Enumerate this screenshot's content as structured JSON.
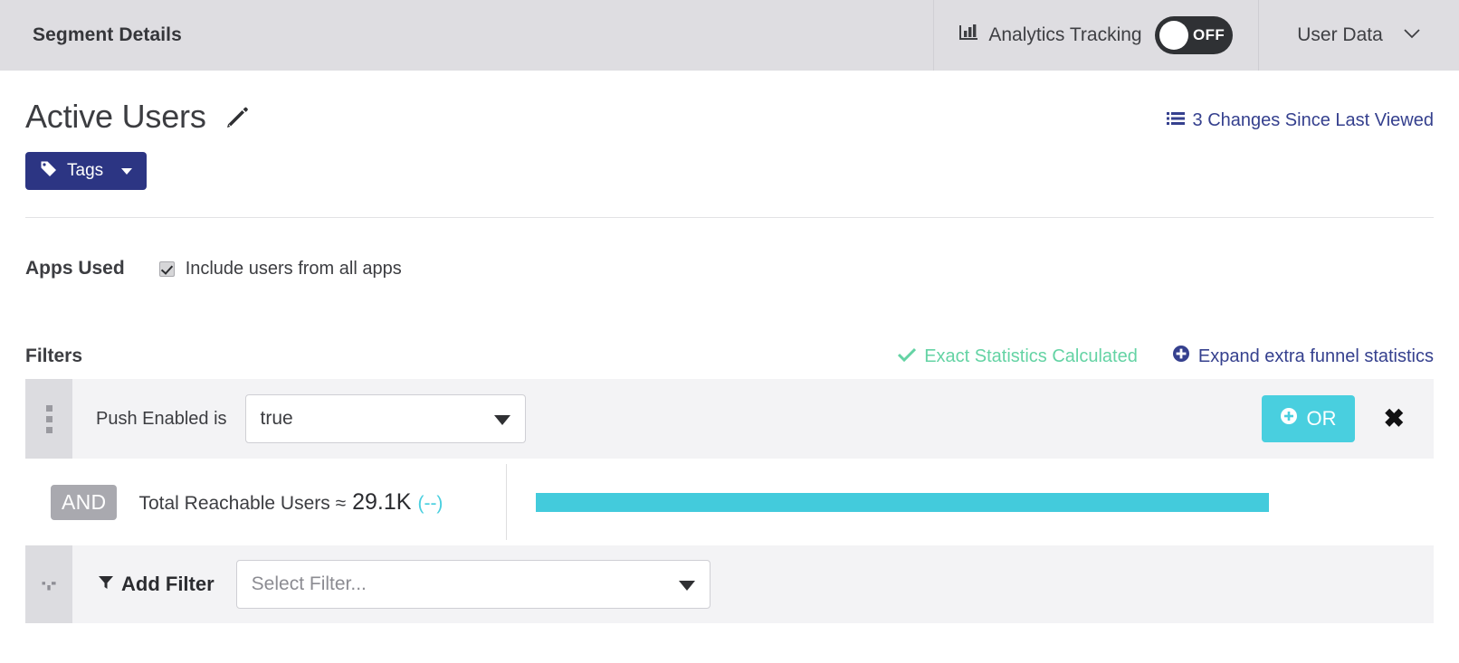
{
  "topbar": {
    "title": "Segment Details",
    "analytics_icon": "bar-chart-icon",
    "analytics_label": "Analytics Tracking",
    "toggle_state": "OFF",
    "user_menu_label": "User Data",
    "user_menu_icon": "chevron-down-icon"
  },
  "segment": {
    "name": "Active Users",
    "edit_icon": "pencil-icon",
    "changes_icon": "list-icon",
    "changes_label": "3 Changes Since Last Viewed",
    "tags_icon": "tag-icon",
    "tags_label": "Tags"
  },
  "apps": {
    "label": "Apps Used",
    "checkbox_checked": true,
    "checkbox_label": "Include users from all apps"
  },
  "filters": {
    "label": "Filters",
    "exact_stats_icon": "check-icon",
    "exact_stats_label": "Exact Statistics Calculated",
    "expand_icon": "plus-circle-icon",
    "expand_label": "Expand extra funnel statistics",
    "rows": [
      {
        "handle_icon": "drag-handle-icon",
        "field_label": "Push Enabled is",
        "value": "true",
        "or_icon": "plus-circle-icon",
        "or_label": "OR",
        "remove_icon": "close-icon"
      }
    ],
    "connector": "AND",
    "total": {
      "label": "Total Reachable Users ≈",
      "value": "29.1K",
      "delta": "(--)",
      "bar_percent": 94
    },
    "add": {
      "handle_icon": "plus-icon",
      "filter_icon": "funnel-icon",
      "label": "Add Filter",
      "select_placeholder": "Select Filter..."
    }
  },
  "colors": {
    "accent_navy": "#2c3583",
    "accent_turquoise": "#49cfdf",
    "accent_green": "#64d3a4",
    "topbar_bg": "#dedde1",
    "row_bg": "#f3f3f5"
  }
}
